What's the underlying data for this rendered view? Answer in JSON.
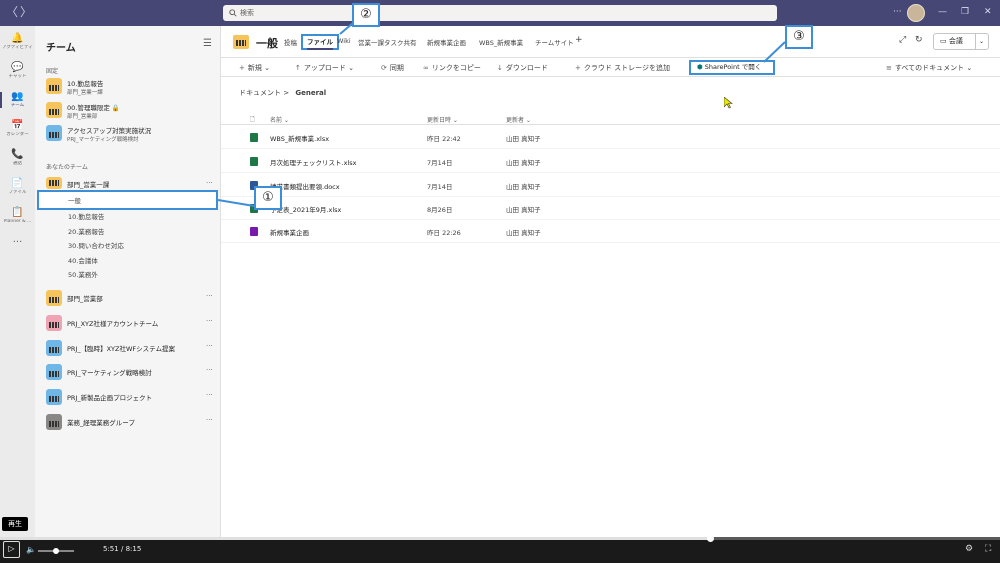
{
  "titlebar": {
    "search_placeholder": "検索",
    "nav_back": "〈",
    "nav_forward": "〉"
  },
  "rail": [
    {
      "icon": "bell-icon",
      "glyph": "🔔",
      "label": "アクティビティ"
    },
    {
      "icon": "chat-icon",
      "glyph": "💬",
      "label": "チャット"
    },
    {
      "icon": "teams-icon",
      "glyph": "👥",
      "label": "チーム"
    },
    {
      "icon": "calendar-icon",
      "glyph": "📅",
      "label": "カレンダー"
    },
    {
      "icon": "phone-icon",
      "glyph": "📞",
      "label": "通話"
    },
    {
      "icon": "file-icon",
      "glyph": "📄",
      "label": "ファイル"
    },
    {
      "icon": "planner-icon",
      "glyph": "📋",
      "label": "Planner & ..."
    },
    {
      "icon": "more-icon",
      "glyph": "···",
      "label": ""
    }
  ],
  "teampane": {
    "title": "チーム",
    "pinned_label": "固定",
    "pinned": [
      {
        "name": "10.勤怠報告",
        "sub": "部門_営業一課"
      },
      {
        "name": "00.管理職限定 🔒",
        "sub": "部門_営業部"
      },
      {
        "name": "アクセスアップ対策実施状況",
        "sub": "PRJ_マーケティング戦略検討"
      }
    ],
    "your_teams_label": "あなたのチーム",
    "team_expanded": "部門_営業一課",
    "channels": [
      "一般",
      "10.勤怠報告",
      "20.業務報告",
      "30.問い合わせ対応",
      "40.会議体",
      "50.業務外"
    ],
    "teams": [
      "部門_営業部",
      "PRJ_XYZ社様アカウントチーム",
      "PRJ_【臨時】XYZ社WFシステム提案",
      "PRJ_マーケティング戦略検討",
      "PRJ_新製品企画プロジェクト",
      "業務_経理業務グループ"
    ],
    "more": "···"
  },
  "channel": {
    "title": "一般",
    "tabs": [
      "投稿",
      "ファイル",
      "Wiki",
      "営業一課タスク共有",
      "新規事業企画",
      "WBS_新規事業",
      "チームサイト",
      "+"
    ],
    "meeting": "会議"
  },
  "toolbar": {
    "new": "新規",
    "upload": "アップロード",
    "sync": "同期",
    "copy_link": "リンクをコピー",
    "download": "ダウンロード",
    "add_cloud": "クラウド ストレージを追加",
    "open_sharepoint": "SharePoint で開く",
    "all_docs": "すべてのドキュメント"
  },
  "breadcrumb": {
    "root": "ドキュメント",
    "sep": ">",
    "current": "General"
  },
  "files": {
    "headers": [
      "名前",
      "更新日時",
      "更新者"
    ],
    "rows": [
      {
        "type": "x",
        "name": "WBS_新規事業.xlsx",
        "date": "昨日 22:42",
        "by": "山田 真知子"
      },
      {
        "type": "x",
        "name": "月次処理チェックリスト.xlsx",
        "date": "7月14日",
        "by": "山田 真知子"
      },
      {
        "type": "w",
        "name": "請求書類提出要領.docx",
        "date": "7月14日",
        "by": "山田 真知子"
      },
      {
        "type": "x",
        "name": "予定表_2021年9月.xlsx",
        "date": "8月26日",
        "by": "山田 真知子"
      },
      {
        "type": "o",
        "name": "新規事業企画",
        "date": "昨日 22:26",
        "by": "山田 真知子"
      }
    ]
  },
  "callouts": [
    "①",
    "②",
    "③"
  ],
  "video": {
    "tooltip": "再生",
    "current": "5:51",
    "sep": "/",
    "total": "8:15",
    "progress": 0.71,
    "volume": 0.5
  },
  "colors": {
    "titlebar": "#464775",
    "highlight": "#3d8ed8",
    "rail": "#ebebeb"
  }
}
